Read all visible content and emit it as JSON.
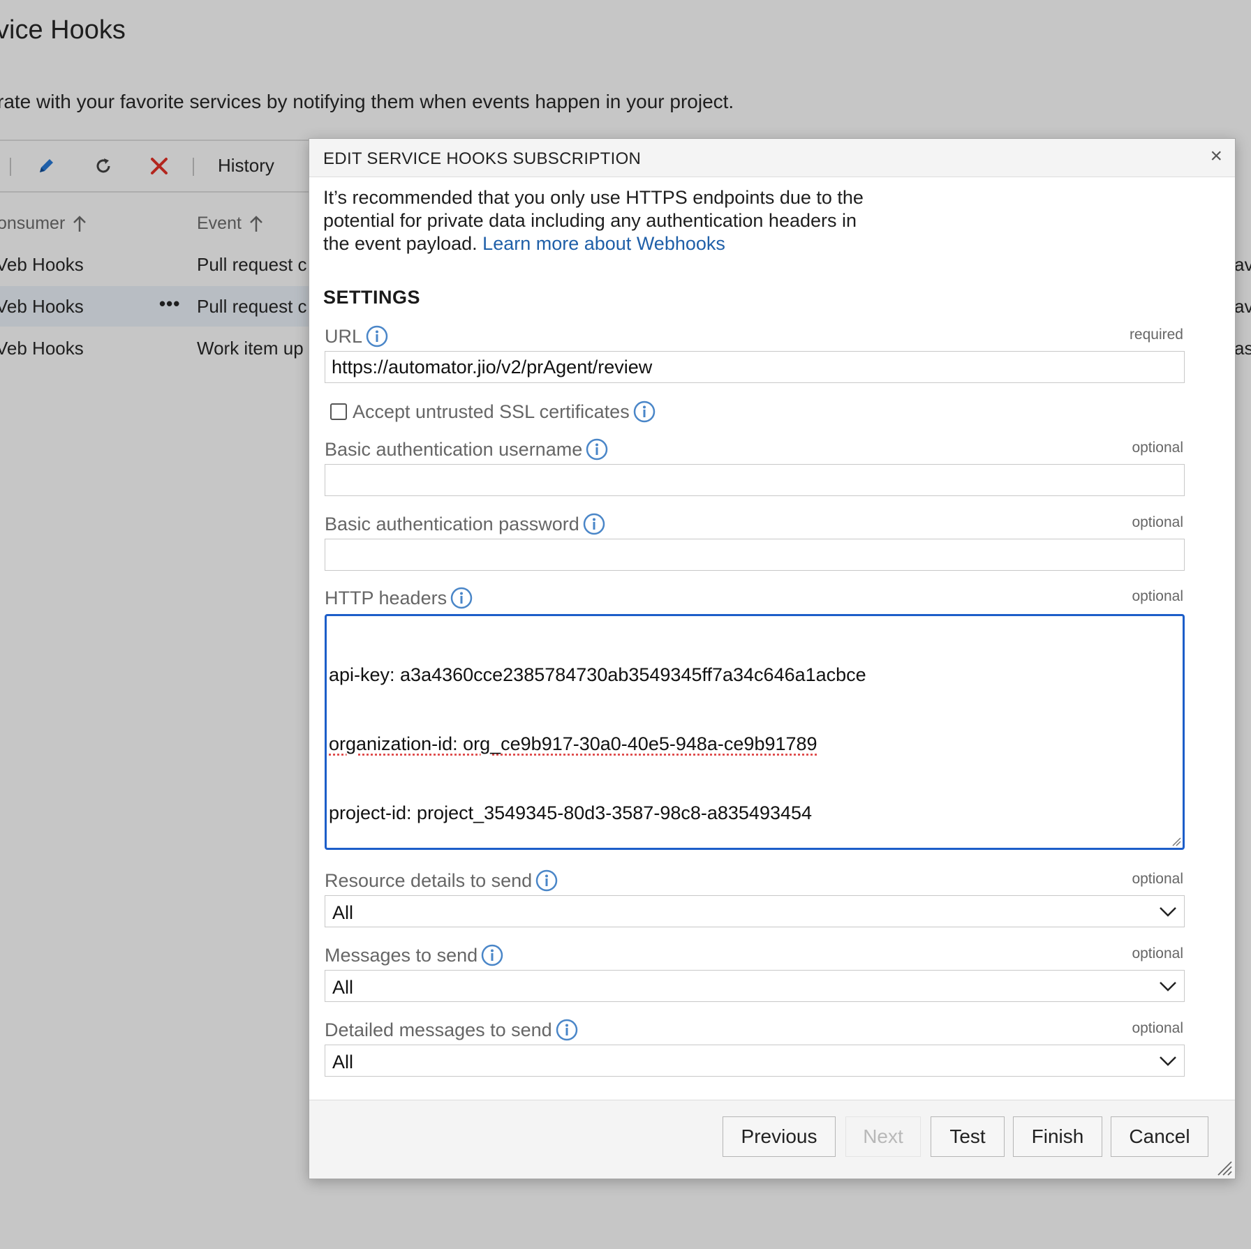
{
  "page": {
    "title": "vice Hooks",
    "description": "rate with your favorite services by notifying them when events happen in your project."
  },
  "toolbar": {
    "history_label": "History"
  },
  "table": {
    "columns": [
      "onsumer",
      "Event"
    ],
    "rows": [
      {
        "consumer": "Veb Hooks",
        "event": "Pull request c",
        "right": "av"
      },
      {
        "consumer": "Veb Hooks",
        "event": "Pull request c",
        "right": "av",
        "more": "•••"
      },
      {
        "consumer": "Veb Hooks",
        "event": "Work item up",
        "right": "as"
      }
    ]
  },
  "dialog": {
    "title": "EDIT SERVICE HOOKS SUBSCRIPTION",
    "close_label": "×",
    "intro_text": "It’s recommended that you only use HTTPS endpoints due to the potential for private data including any authentication headers in the event payload. ",
    "learn_more_link": "Learn more about Webhooks",
    "settings_title": "SETTINGS",
    "fields": {
      "url": {
        "label": "URL",
        "note": "required",
        "value": "https://automator.jio/v2/prAgent/review"
      },
      "ssl": {
        "label": "Accept untrusted SSL certificates",
        "checked": false
      },
      "username": {
        "label": "Basic authentication username",
        "note": "optional",
        "value": ""
      },
      "password": {
        "label": "Basic authentication password",
        "note": "optional",
        "value": ""
      },
      "headers": {
        "label": "HTTP headers",
        "note": "optional",
        "lines": [
          "api-key: a3a4360cce2385784730ab3549345ff7a34c646a1acbce",
          "organization-id: org_ce9b917-30a0-40e5-948a-ce9b91789",
          "project-id: project_3549345-80d3-3587-98c8-a835493454"
        ]
      },
      "resource_details": {
        "label": "Resource details to send",
        "note": "optional",
        "value": "All"
      },
      "messages": {
        "label": "Messages to send",
        "note": "optional",
        "value": "All"
      },
      "detailed_messages": {
        "label": "Detailed messages to send",
        "note": "optional",
        "value": "All"
      }
    },
    "buttons": {
      "previous": "Previous",
      "next": "Next",
      "test": "Test",
      "finish": "Finish",
      "cancel": "Cancel"
    }
  },
  "colors": {
    "accent": "#1d5ec9",
    "link": "#1f5fa8",
    "info_icon": "#4a86c8",
    "delete_icon": "#b3261e",
    "overlay_bg": "#c6c6c6"
  },
  "icons": [
    "pencil-icon",
    "refresh-icon",
    "delete-icon",
    "sort-up-icon",
    "info-icon",
    "chevron-down-icon",
    "close-icon",
    "resize-grip-icon"
  ]
}
